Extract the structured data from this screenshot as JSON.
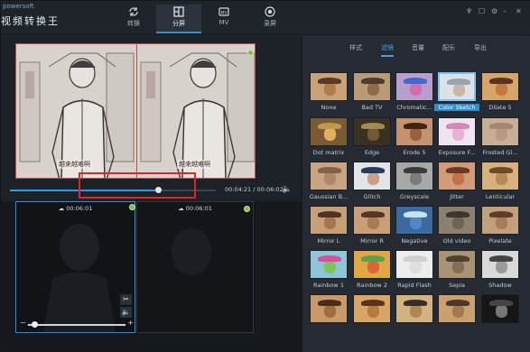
{
  "brand": {
    "small": "powersoft",
    "title": "视频转换王"
  },
  "nav": [
    {
      "label": "转换",
      "icon": "refresh-icon",
      "active": false
    },
    {
      "label": "分屏",
      "icon": "split-screen-icon",
      "active": true
    },
    {
      "label": "MV",
      "icon": "mv-icon",
      "active": false
    },
    {
      "label": "录屏",
      "icon": "record-icon",
      "active": false
    }
  ],
  "preview": {
    "subtitle": "越来越难啊",
    "time": "00:04:21 / 00:06:02"
  },
  "seek_progress": 0.72,
  "panels": [
    {
      "duration": "00:06:01"
    },
    {
      "duration": "00:06:01"
    }
  ],
  "right_tabs": [
    {
      "label": "样式",
      "active": false
    },
    {
      "label": "滤镜",
      "active": true
    },
    {
      "label": "音量",
      "active": false
    },
    {
      "label": "配乐",
      "active": false
    },
    {
      "label": "导出",
      "active": false
    }
  ],
  "filters": [
    {
      "label": "None",
      "bg": "#c9a27a",
      "hat": "#5a3a2a",
      "dog": "#b07b47"
    },
    {
      "label": "Bad TV",
      "bg": "#b89a78",
      "hat": "#4d3a30",
      "dog": "#8f6a48"
    },
    {
      "label": "Chromatic...",
      "bg": "#b79ecf",
      "hat": "#3f6acc",
      "dog": "#d46bb0"
    },
    {
      "label": "Color Sketch",
      "bg": "#dde2e6",
      "hat": "#9aa4ae",
      "dog": "#c9b7a4",
      "selected": true
    },
    {
      "label": "Dilate 5",
      "bg": "#d7a56a",
      "hat": "#5b3322",
      "dog": "#c07a3b"
    },
    {
      "label": "Dot matrix",
      "bg": "#7a5a35",
      "hat": "#c4964c",
      "dog": "#e0b060"
    },
    {
      "label": "Edge",
      "bg": "#3a3022",
      "hat": "#a38850",
      "dog": "#6f5a36"
    },
    {
      "label": "Erode 5",
      "bg": "#c49270",
      "hat": "#402417",
      "dog": "#9a5f3d"
    },
    {
      "label": "Exposure F...",
      "bg": "#f0e4ee",
      "hat": "#d48ab8",
      "dog": "#e8b3d3"
    },
    {
      "label": "Frosted Gl...",
      "bg": "#c7ae95",
      "hat": "#a48770",
      "dog": "#b89a7f"
    },
    {
      "label": "Gaussian B...",
      "bg": "#c9a482",
      "hat": "#80624a",
      "dog": "#ae8862"
    },
    {
      "label": "Glitch",
      "bg": "#e2e4e8",
      "hat": "#2a3a5c",
      "dog": "#c7a28a"
    },
    {
      "label": "Greyscale",
      "bg": "#a8a8a8",
      "hat": "#3a3a3a",
      "dog": "#7c7c7c"
    },
    {
      "label": "Jitter",
      "bg": "#d39b78",
      "hat": "#6b3a2a",
      "dog": "#c0724a"
    },
    {
      "label": "Lenticular",
      "bg": "#d7b27f",
      "hat": "#6c4a2c",
      "dog": "#bb8855"
    },
    {
      "label": "Mirror L",
      "bg": "#c69e78",
      "hat": "#4f3326",
      "dog": "#a8764c"
    },
    {
      "label": "Mirror R",
      "bg": "#c89f79",
      "hat": "#54362a",
      "dog": "#ab7a50"
    },
    {
      "label": "Negative",
      "bg": "#3b6aa0",
      "hat": "#c9e0f0",
      "dog": "#4f88c4"
    },
    {
      "label": "Old video",
      "bg": "#8a8070",
      "hat": "#3c362e",
      "dog": "#6e6456"
    },
    {
      "label": "Pixelate",
      "bg": "#c3a07c",
      "hat": "#5c3c2c",
      "dog": "#a87c55"
    },
    {
      "label": "Rainbow 1",
      "bg": "#8ec6d8",
      "hat": "#d94fa0",
      "dog": "#7bc55a"
    },
    {
      "label": "Rainbow 2",
      "bg": "#e0a844",
      "hat": "#5ea04a",
      "dog": "#d8673a"
    },
    {
      "label": "Rapid Flash",
      "bg": "#ededed",
      "hat": "#cfcfcf",
      "dog": "#dedede"
    },
    {
      "label": "Sepia",
      "bg": "#a89474",
      "hat": "#4e4030",
      "dog": "#857055"
    },
    {
      "label": "Shadow",
      "bg": "#d9d9d9",
      "hat": "#444444",
      "dog": "#9b9b9b"
    },
    {
      "label": "",
      "bg": "#c89a6a",
      "hat": "#4a2c1e",
      "dog": "#a46c3e"
    },
    {
      "label": "",
      "bg": "#d9a668",
      "hat": "#563420",
      "dog": "#b47a40"
    },
    {
      "label": "",
      "bg": "#d2b27e",
      "hat": "#3a2e2a",
      "dog": "#b08656"
    },
    {
      "label": "",
      "bg": "#c9a070",
      "hat": "#50362a",
      "dog": "#a57850"
    },
    {
      "label": "",
      "bg": "#161616",
      "hat": "#444444",
      "dog": "#777777"
    }
  ]
}
